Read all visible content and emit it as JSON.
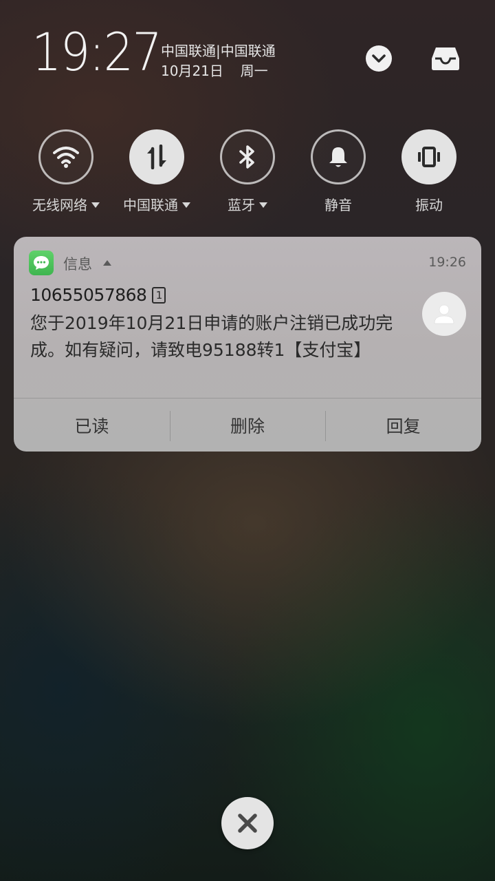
{
  "status": {
    "time": "19:27",
    "carriers": "中国联通|中国联通",
    "date": "10月21日",
    "weekday": "周一"
  },
  "header": {
    "collapse_icon": "chevron-down-icon",
    "tray_icon": "inbox-tray-icon"
  },
  "toggles": [
    {
      "label": "无线网络",
      "icon": "wifi-icon",
      "active": false,
      "has_menu": true
    },
    {
      "label": "中国联通",
      "icon": "mobile-data-icon",
      "active": true,
      "has_menu": true
    },
    {
      "label": "蓝牙",
      "icon": "bluetooth-icon",
      "active": false,
      "has_menu": true
    },
    {
      "label": "静音",
      "icon": "bell-icon",
      "active": false,
      "has_menu": false
    },
    {
      "label": "振动",
      "icon": "vibrate-icon",
      "active": true,
      "has_menu": false
    }
  ],
  "notification": {
    "app_name": "信息",
    "app_icon": "message-bubble-icon",
    "time": "19:26",
    "sender": "10655057868",
    "sim_slot": "1",
    "message": "您于2019年10月21日申请的账户注销已成功完成。如有疑问，请致电95188转1【支付宝】",
    "avatar_icon": "contact-avatar-icon",
    "actions": {
      "mark_read": "已读",
      "delete": "删除",
      "reply": "回复"
    }
  },
  "close_icon": "close-icon",
  "colors": {
    "toggle_active": "#e3e3e3",
    "card_bg": "#b7b3b5",
    "app_icon_green": "#4cc35a"
  }
}
